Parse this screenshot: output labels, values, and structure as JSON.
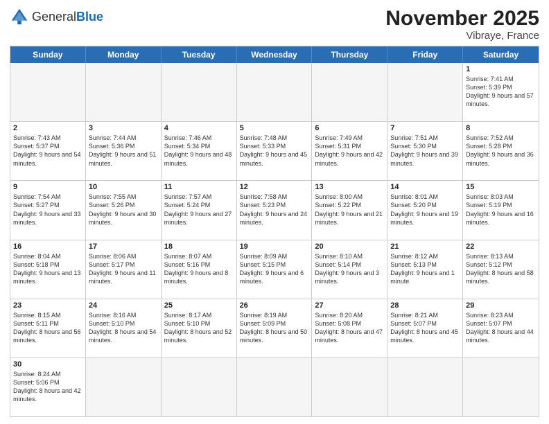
{
  "header": {
    "logo_general": "General",
    "logo_blue": "Blue",
    "title": "November 2025",
    "subtitle": "Vibraye, France"
  },
  "weekdays": [
    "Sunday",
    "Monday",
    "Tuesday",
    "Wednesday",
    "Thursday",
    "Friday",
    "Saturday"
  ],
  "rows": [
    [
      {
        "day": "",
        "info": "",
        "empty": true
      },
      {
        "day": "",
        "info": "",
        "empty": true
      },
      {
        "day": "",
        "info": "",
        "empty": true
      },
      {
        "day": "",
        "info": "",
        "empty": true
      },
      {
        "day": "",
        "info": "",
        "empty": true
      },
      {
        "day": "",
        "info": "",
        "empty": true
      },
      {
        "day": "1",
        "info": "Sunrise: 7:41 AM\nSunset: 5:39 PM\nDaylight: 9 hours\nand 57 minutes."
      }
    ],
    [
      {
        "day": "2",
        "info": "Sunrise: 7:43 AM\nSunset: 5:37 PM\nDaylight: 9 hours\nand 54 minutes."
      },
      {
        "day": "3",
        "info": "Sunrise: 7:44 AM\nSunset: 5:36 PM\nDaylight: 9 hours\nand 51 minutes."
      },
      {
        "day": "4",
        "info": "Sunrise: 7:46 AM\nSunset: 5:34 PM\nDaylight: 9 hours\nand 48 minutes."
      },
      {
        "day": "5",
        "info": "Sunrise: 7:48 AM\nSunset: 5:33 PM\nDaylight: 9 hours\nand 45 minutes."
      },
      {
        "day": "6",
        "info": "Sunrise: 7:49 AM\nSunset: 5:31 PM\nDaylight: 9 hours\nand 42 minutes."
      },
      {
        "day": "7",
        "info": "Sunrise: 7:51 AM\nSunset: 5:30 PM\nDaylight: 9 hours\nand 39 minutes."
      },
      {
        "day": "8",
        "info": "Sunrise: 7:52 AM\nSunset: 5:28 PM\nDaylight: 9 hours\nand 36 minutes."
      }
    ],
    [
      {
        "day": "9",
        "info": "Sunrise: 7:54 AM\nSunset: 5:27 PM\nDaylight: 9 hours\nand 33 minutes."
      },
      {
        "day": "10",
        "info": "Sunrise: 7:55 AM\nSunset: 5:26 PM\nDaylight: 9 hours\nand 30 minutes."
      },
      {
        "day": "11",
        "info": "Sunrise: 7:57 AM\nSunset: 5:24 PM\nDaylight: 9 hours\nand 27 minutes."
      },
      {
        "day": "12",
        "info": "Sunrise: 7:58 AM\nSunset: 5:23 PM\nDaylight: 9 hours\nand 24 minutes."
      },
      {
        "day": "13",
        "info": "Sunrise: 8:00 AM\nSunset: 5:22 PM\nDaylight: 9 hours\nand 21 minutes."
      },
      {
        "day": "14",
        "info": "Sunrise: 8:01 AM\nSunset: 5:20 PM\nDaylight: 9 hours\nand 19 minutes."
      },
      {
        "day": "15",
        "info": "Sunrise: 8:03 AM\nSunset: 5:19 PM\nDaylight: 9 hours\nand 16 minutes."
      }
    ],
    [
      {
        "day": "16",
        "info": "Sunrise: 8:04 AM\nSunset: 5:18 PM\nDaylight: 9 hours\nand 13 minutes."
      },
      {
        "day": "17",
        "info": "Sunrise: 8:06 AM\nSunset: 5:17 PM\nDaylight: 9 hours\nand 11 minutes."
      },
      {
        "day": "18",
        "info": "Sunrise: 8:07 AM\nSunset: 5:16 PM\nDaylight: 9 hours\nand 8 minutes."
      },
      {
        "day": "19",
        "info": "Sunrise: 8:09 AM\nSunset: 5:15 PM\nDaylight: 9 hours\nand 6 minutes."
      },
      {
        "day": "20",
        "info": "Sunrise: 8:10 AM\nSunset: 5:14 PM\nDaylight: 9 hours\nand 3 minutes."
      },
      {
        "day": "21",
        "info": "Sunrise: 8:12 AM\nSunset: 5:13 PM\nDaylight: 9 hours\nand 1 minute."
      },
      {
        "day": "22",
        "info": "Sunrise: 8:13 AM\nSunset: 5:12 PM\nDaylight: 8 hours\nand 58 minutes."
      }
    ],
    [
      {
        "day": "23",
        "info": "Sunrise: 8:15 AM\nSunset: 5:11 PM\nDaylight: 8 hours\nand 56 minutes."
      },
      {
        "day": "24",
        "info": "Sunrise: 8:16 AM\nSunset: 5:10 PM\nDaylight: 8 hours\nand 54 minutes."
      },
      {
        "day": "25",
        "info": "Sunrise: 8:17 AM\nSunset: 5:10 PM\nDaylight: 8 hours\nand 52 minutes."
      },
      {
        "day": "26",
        "info": "Sunrise: 8:19 AM\nSunset: 5:09 PM\nDaylight: 8 hours\nand 50 minutes."
      },
      {
        "day": "27",
        "info": "Sunrise: 8:20 AM\nSunset: 5:08 PM\nDaylight: 8 hours\nand 47 minutes."
      },
      {
        "day": "28",
        "info": "Sunrise: 8:21 AM\nSunset: 5:07 PM\nDaylight: 8 hours\nand 45 minutes."
      },
      {
        "day": "29",
        "info": "Sunrise: 8:23 AM\nSunset: 5:07 PM\nDaylight: 8 hours\nand 44 minutes."
      }
    ],
    [
      {
        "day": "30",
        "info": "Sunrise: 8:24 AM\nSunset: 5:06 PM\nDaylight: 8 hours\nand 42 minutes."
      },
      {
        "day": "",
        "info": "",
        "empty": true
      },
      {
        "day": "",
        "info": "",
        "empty": true
      },
      {
        "day": "",
        "info": "",
        "empty": true
      },
      {
        "day": "",
        "info": "",
        "empty": true
      },
      {
        "day": "",
        "info": "",
        "empty": true
      },
      {
        "day": "",
        "info": "",
        "empty": true
      }
    ]
  ]
}
